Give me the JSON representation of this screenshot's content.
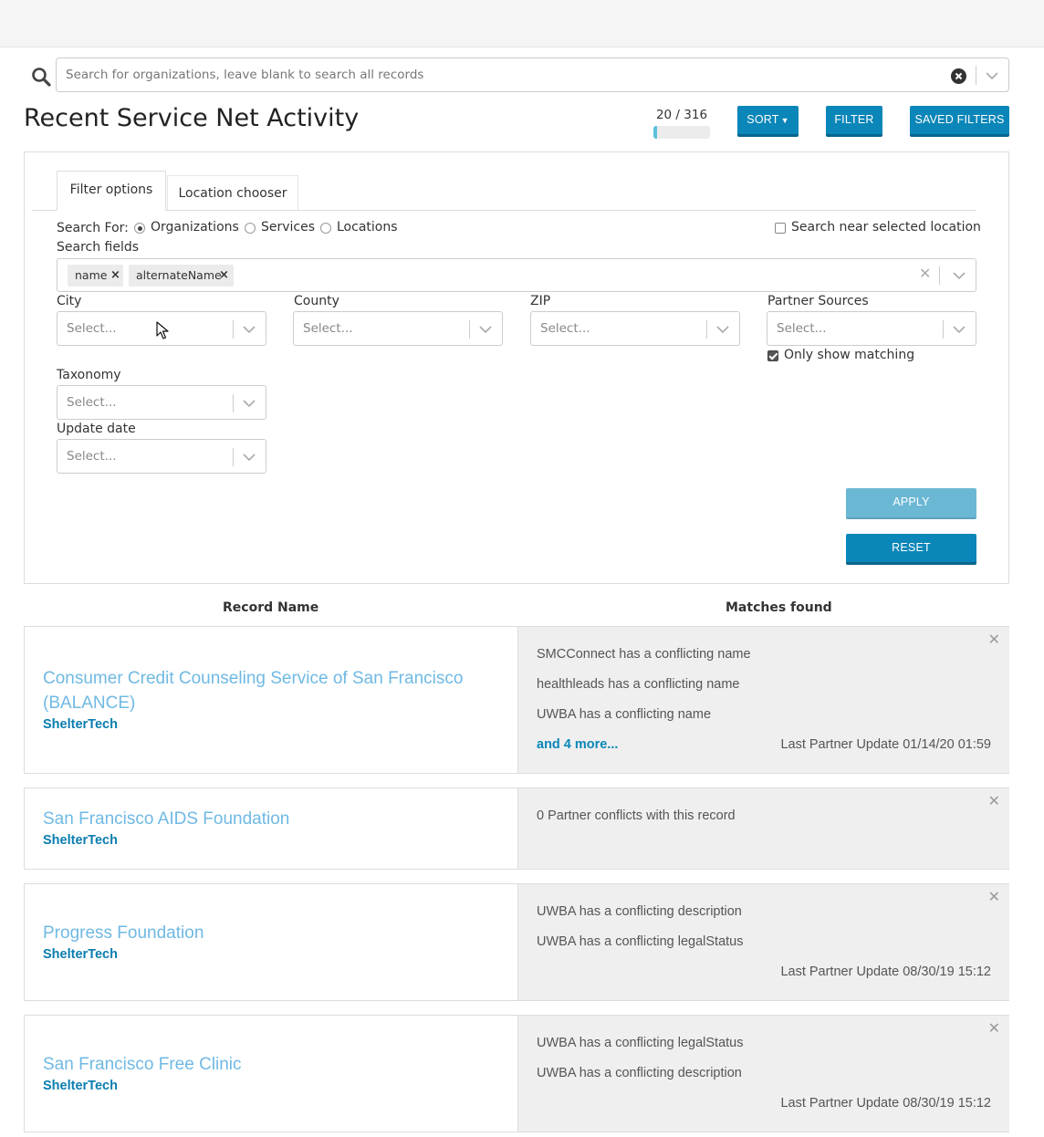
{
  "search": {
    "placeholder": "Search for organizations, leave blank to search all records"
  },
  "header": {
    "title": "Recent Service Net Activity",
    "count_label": "20 / 316",
    "progress_fraction": 0.063,
    "sort_label": "SORT",
    "filter_label": "FILTER",
    "saved_filters_label": "SAVED FILTERS"
  },
  "filter": {
    "tabs": [
      "Filter options",
      "Location chooser"
    ],
    "search_for_label": "Search For:",
    "search_for_options": [
      "Organizations",
      "Services",
      "Locations"
    ],
    "search_for_selected": "Organizations",
    "search_near_label": "Search near selected location",
    "search_fields_label": "Search fields",
    "search_fields_tags": [
      "name",
      "alternateName"
    ],
    "city_label": "City",
    "county_label": "County",
    "zip_label": "ZIP",
    "partner_sources_label": "Partner Sources",
    "only_show_matching_label": "Only show matching",
    "taxonomy_label": "Taxonomy",
    "update_date_label": "Update date",
    "select_placeholder": "Select...",
    "apply_label": "APPLY",
    "reset_label": "RESET"
  },
  "results": {
    "col_record_name": "Record Name",
    "col_matches_found": "Matches found",
    "rows": [
      {
        "name": "Consumer Credit Counseling Service of San Francisco (BALANCE)",
        "source": "ShelterTech",
        "conflicts": [
          "SMCConnect has a conflicting name",
          "healthleads has a conflicting name",
          "UWBA has a conflicting name"
        ],
        "more": "and 4 more...",
        "updated": "Last Partner Update 01/14/20 01:59"
      },
      {
        "name": "San Francisco AIDS Foundation",
        "source": "ShelterTech",
        "conflicts": [
          "0 Partner conflicts with this record"
        ]
      },
      {
        "name": "Progress Foundation",
        "source": "ShelterTech",
        "conflicts": [
          "UWBA has a conflicting description",
          "UWBA has a conflicting legalStatus"
        ],
        "updated": "Last Partner Update 08/30/19 15:12"
      },
      {
        "name": "San Francisco Free Clinic",
        "source": "ShelterTech",
        "conflicts": [
          "UWBA has a conflicting legalStatus",
          "UWBA has a conflicting description"
        ],
        "updated": "Last Partner Update 08/30/19 15:12"
      }
    ]
  }
}
